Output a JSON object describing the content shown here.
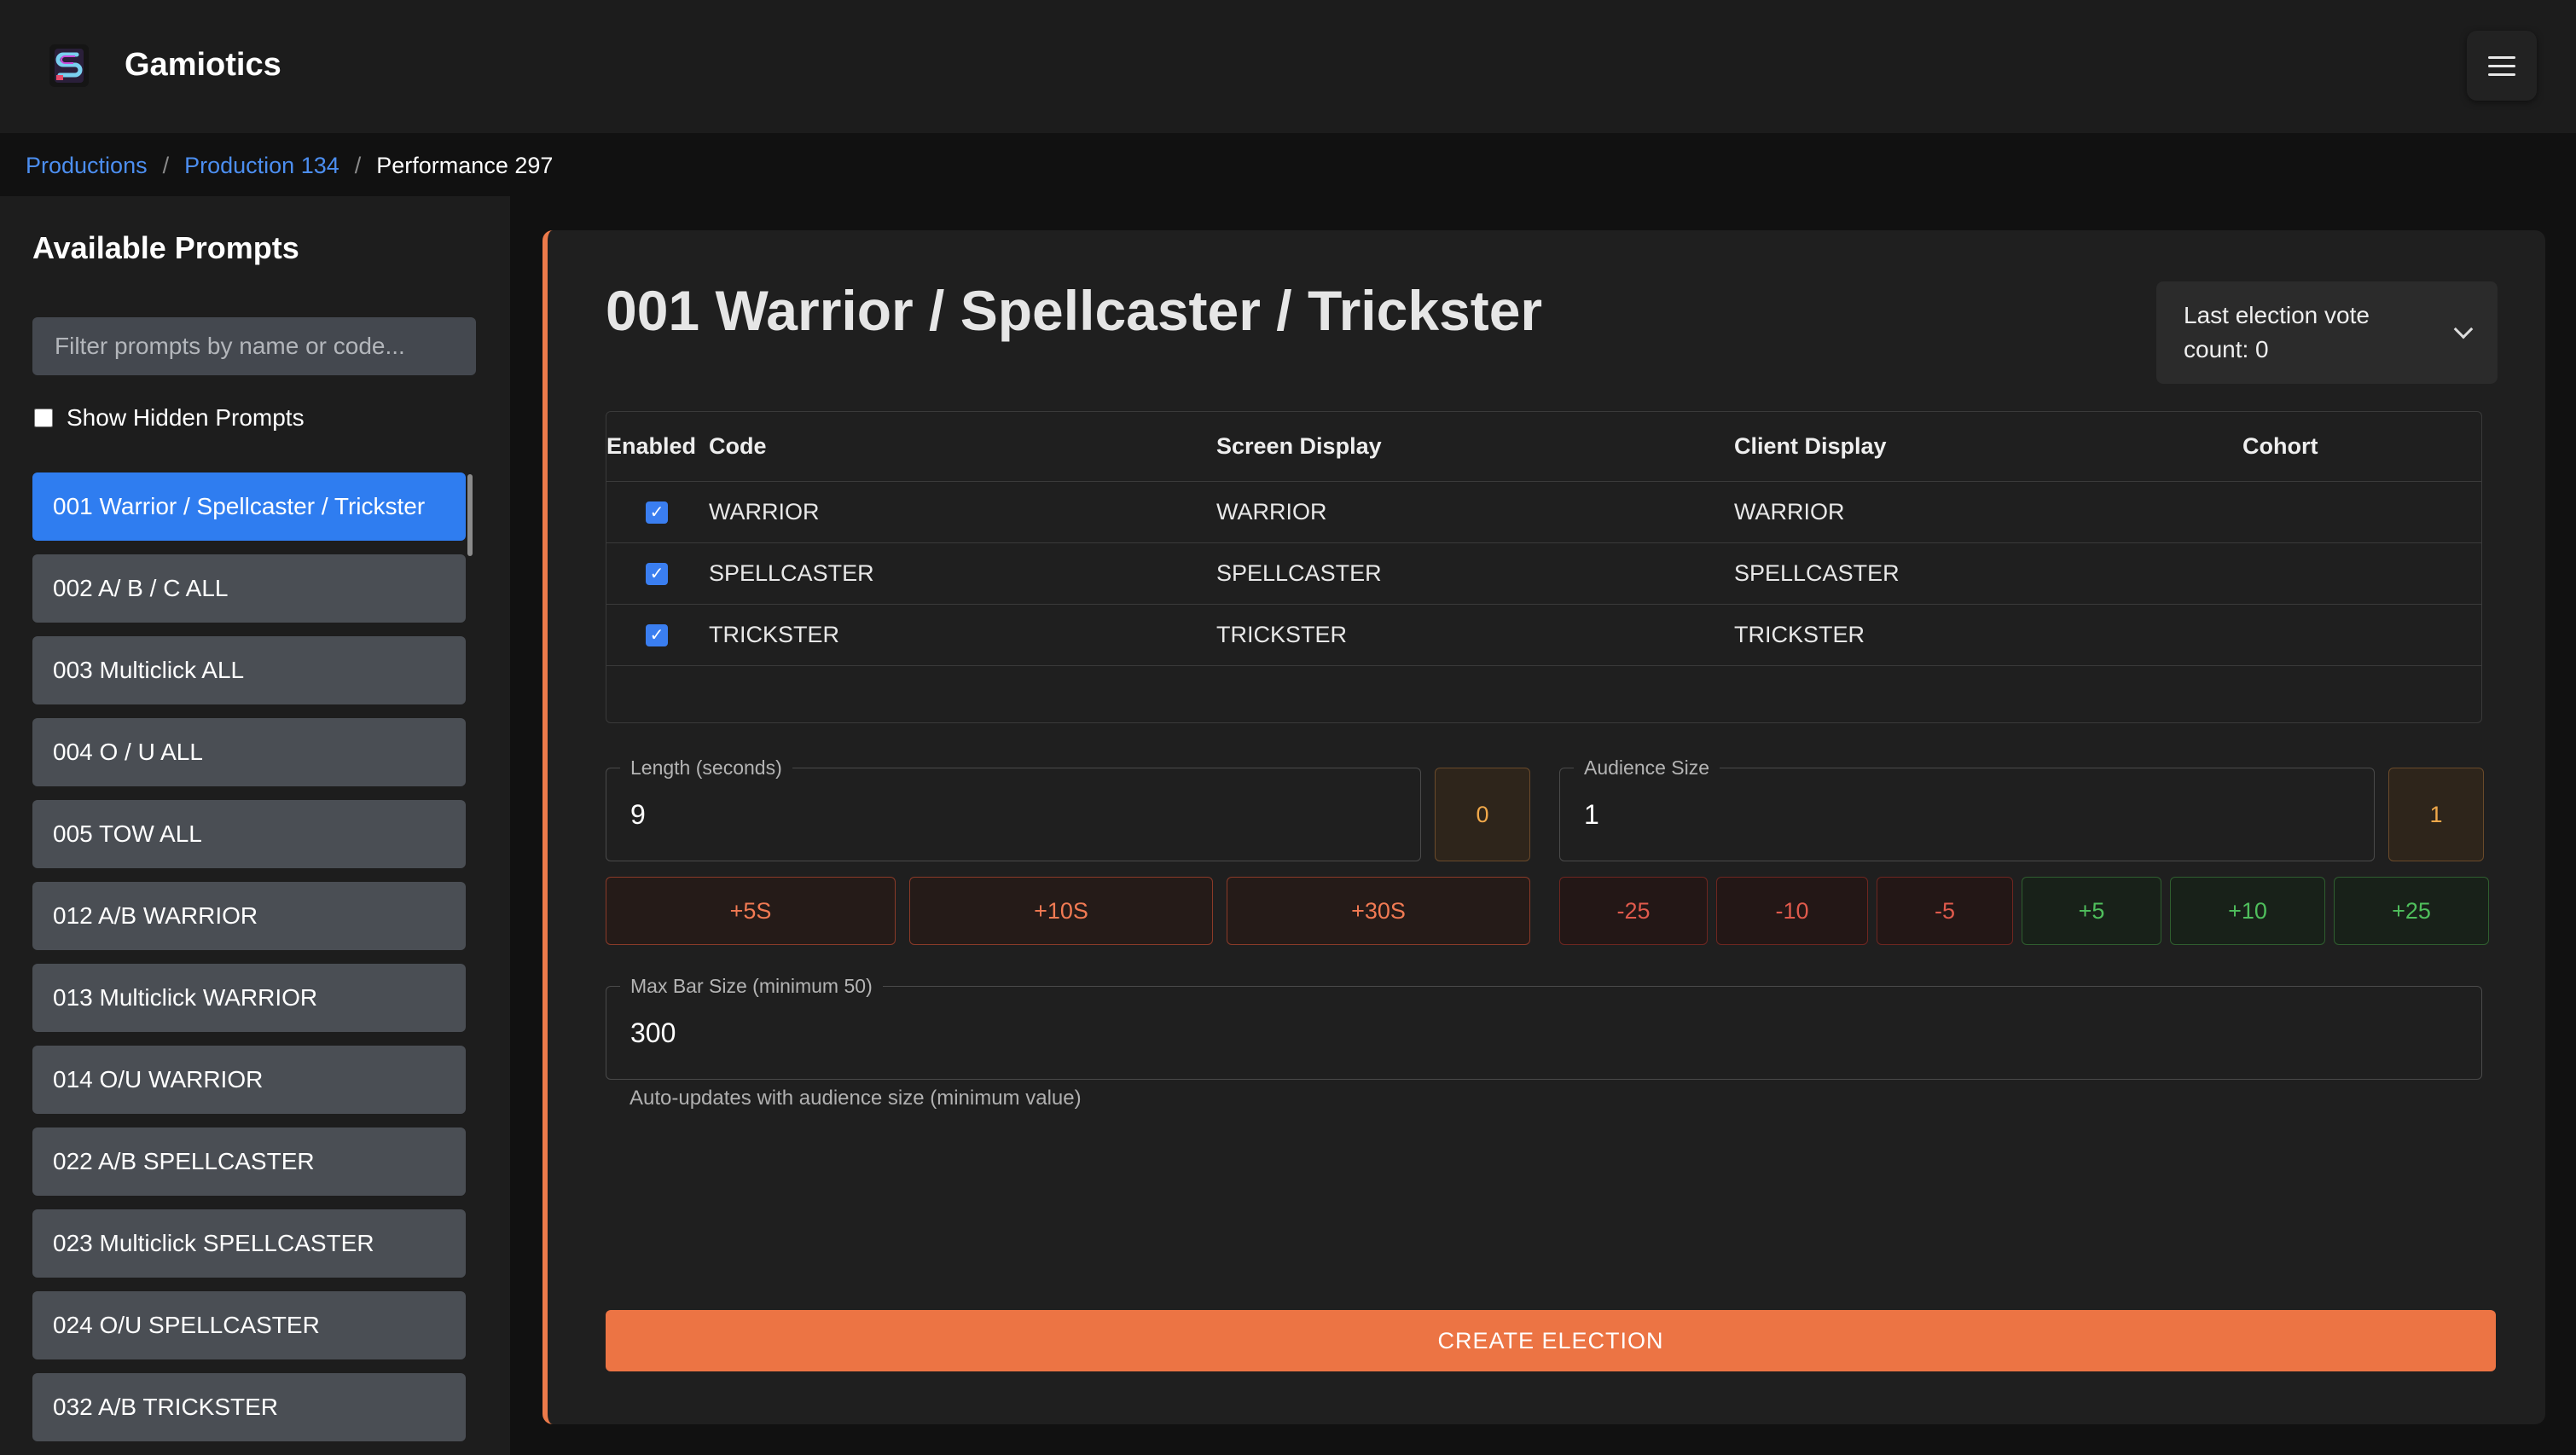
{
  "app": {
    "title": "Gamiotics",
    "logo_icon": "gamiotics-logo-icon",
    "menu_icon": "hamburger-menu-icon"
  },
  "breadcrumb": {
    "items": [
      {
        "label": "Productions",
        "link": true
      },
      {
        "label": "Production 134",
        "link": true
      },
      {
        "label": "Performance 297",
        "link": false
      }
    ],
    "separator": "/"
  },
  "sidebar": {
    "title": "Available Prompts",
    "filter_placeholder": "Filter prompts by name or code...",
    "show_hidden_label": "Show Hidden Prompts",
    "show_hidden_checked": false,
    "prompts": [
      {
        "label": "001 Warrior / Spellcaster / Trickster",
        "active": true
      },
      {
        "label": "002 A/ B / C ALL",
        "active": false
      },
      {
        "label": "003 Multiclick ALL",
        "active": false
      },
      {
        "label": "004 O / U ALL",
        "active": false
      },
      {
        "label": "005 TOW ALL",
        "active": false
      },
      {
        "label": "012 A/B WARRIOR",
        "active": false
      },
      {
        "label": "013 Multiclick WARRIOR",
        "active": false
      },
      {
        "label": "014 O/U WARRIOR",
        "active": false
      },
      {
        "label": "022 A/B SPELLCASTER",
        "active": false
      },
      {
        "label": "023 Multiclick SPELLCASTER",
        "active": false
      },
      {
        "label": "024 O/U SPELLCASTER",
        "active": false
      },
      {
        "label": "032 A/B TRICKSTER",
        "active": false
      }
    ]
  },
  "main": {
    "heading": "001 Warrior / Spellcaster / Trickster",
    "vote_dropdown_label": "Last election vote count: 0",
    "table": {
      "headers": [
        "Enabled",
        "Code",
        "Screen Display",
        "Client Display",
        "Cohort"
      ],
      "rows": [
        {
          "enabled": true,
          "code": "WARRIOR",
          "screen": "WARRIOR",
          "client": "WARRIOR",
          "cohort": ""
        },
        {
          "enabled": true,
          "code": "SPELLCASTER",
          "screen": "SPELLCASTER",
          "client": "SPELLCASTER",
          "cohort": ""
        },
        {
          "enabled": true,
          "code": "TRICKSTER",
          "screen": "TRICKSTER",
          "client": "TRICKSTER",
          "cohort": ""
        }
      ]
    },
    "length": {
      "label": "Length (seconds)",
      "value": "9",
      "badge": "0",
      "buttons": [
        "+5S",
        "+10S",
        "+30S"
      ]
    },
    "audience": {
      "label": "Audience Size",
      "value": "1",
      "badge": "1",
      "buttons": [
        "-25",
        "-10",
        "-5",
        "+5",
        "+10",
        "+25"
      ]
    },
    "max_bar": {
      "label": "Max Bar Size (minimum 50)",
      "value": "300",
      "helper": "Auto-updates with audience size (minimum value)"
    },
    "create_button": "CREATE ELECTION"
  },
  "colors": {
    "accent": "#ec7444",
    "link": "#4c8ef0",
    "active_prompt": "#2f7df0",
    "positive": "#4fbf5c",
    "negative": "#e05a4c"
  }
}
